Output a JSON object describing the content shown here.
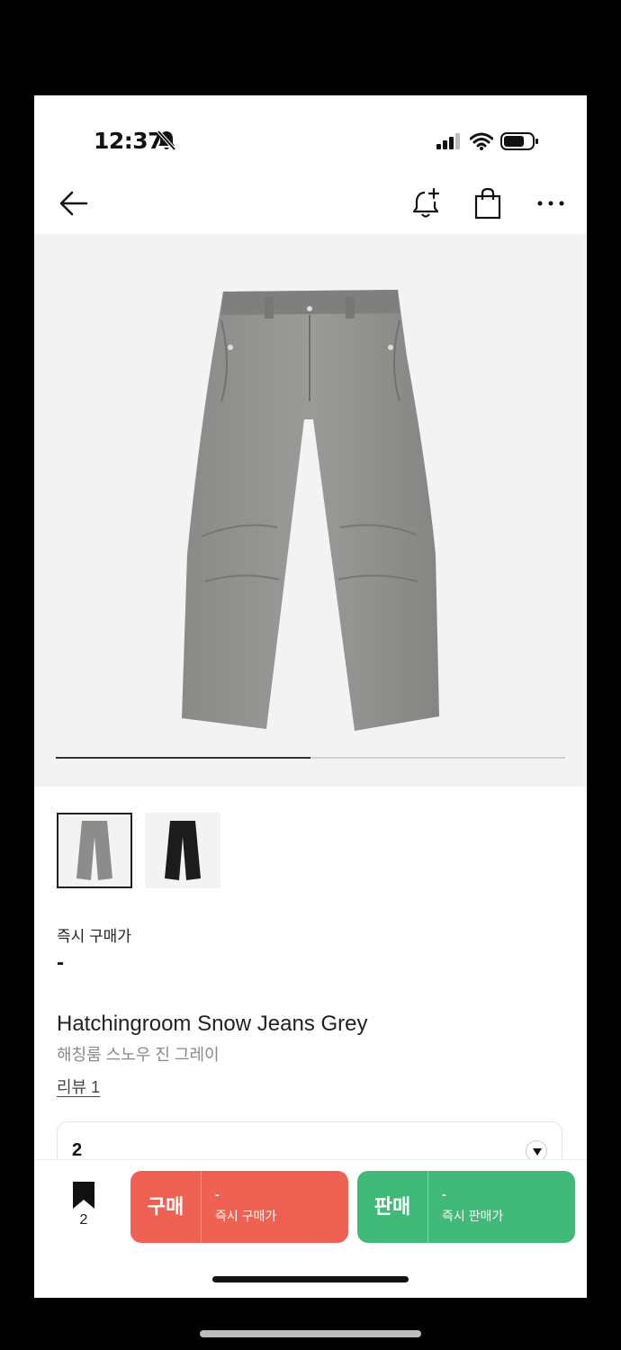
{
  "status": {
    "time": "12:37"
  },
  "product": {
    "instant_buy_label": "즉시 구매가",
    "instant_buy_price": "-",
    "title_en": "Hatchingroom Snow Jeans Grey",
    "title_ko": "해칭룸 스노우 진 그레이",
    "review_link": "리뷰 1",
    "selected_size": "2",
    "image_progress": 0.5,
    "thumbnails": [
      "grey",
      "black"
    ]
  },
  "bottom": {
    "bookmark_count": "2",
    "buy_label": "구매",
    "buy_price": "-",
    "buy_sub": "즉시 구매가",
    "sell_label": "판매",
    "sell_price": "-",
    "sell_sub": "즉시 판매가"
  },
  "colors": {
    "buy": "#ef6253",
    "sell": "#41b979"
  },
  "icons": [
    "bell-off-icon",
    "signal-icon",
    "wifi-icon",
    "battery-icon",
    "back-arrow-icon",
    "bell-add-icon",
    "shopping-bag-icon",
    "more-icon",
    "bookmark-icon",
    "chevron-down-icon"
  ]
}
